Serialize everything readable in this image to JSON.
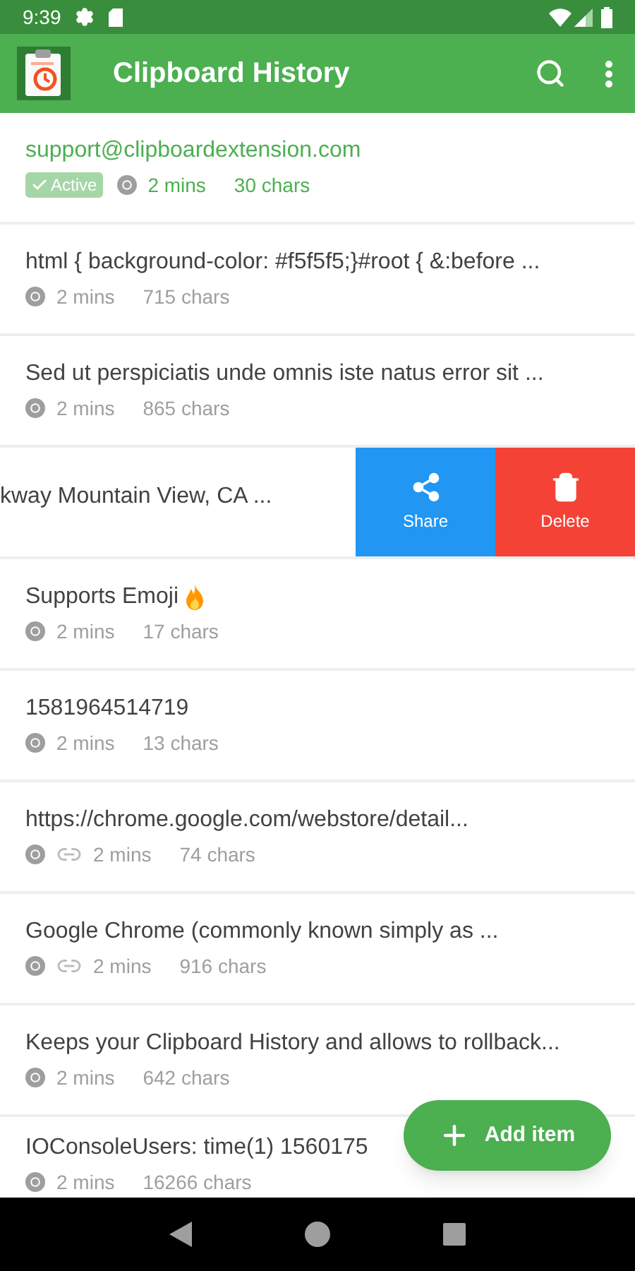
{
  "status_bar": {
    "time": "9:39"
  },
  "app_bar": {
    "title": "Clipboard History"
  },
  "items": [
    {
      "kind": "entry",
      "text": "support@clipboardextension.com",
      "active": true,
      "badge": "Active",
      "link": false,
      "flame": false,
      "time": "2 mins",
      "size": "30 chars"
    },
    {
      "kind": "entry",
      "text": "html { background-color: #f5f5f5;}#root { &:before ...",
      "active": false,
      "link": false,
      "flame": false,
      "time": "2 mins",
      "size": "715 chars"
    },
    {
      "kind": "entry",
      "text": "Sed ut perspiciatis unde omnis iste natus error sit ...",
      "active": false,
      "link": false,
      "flame": false,
      "time": "2 mins",
      "size": "865 chars"
    },
    {
      "kind": "swiped",
      "text": "kway Mountain View, CA ...",
      "actions": [
        {
          "kind": "share",
          "label": "Share"
        },
        {
          "kind": "delete",
          "label": "Delete"
        }
      ]
    },
    {
      "kind": "entry",
      "text": "Supports Emoji",
      "active": false,
      "link": false,
      "flame": true,
      "time": "2 mins",
      "size": "17 chars"
    },
    {
      "kind": "entry",
      "text": "1581964514719",
      "active": false,
      "link": false,
      "flame": false,
      "time": "2 mins",
      "size": "13 chars"
    },
    {
      "kind": "entry",
      "text": "https://chrome.google.com/webstore/detail...",
      "active": false,
      "link": true,
      "flame": false,
      "time": "2 mins",
      "size": "74 chars"
    },
    {
      "kind": "entry",
      "text": "Google Chrome (commonly known simply as ...",
      "active": false,
      "link": true,
      "flame": false,
      "time": "2 mins",
      "size": "916 chars"
    },
    {
      "kind": "entry",
      "text": "Keeps your Clipboard History and allows to rollback...",
      "active": false,
      "link": false,
      "flame": false,
      "time": "2 mins",
      "size": "642 chars"
    },
    {
      "kind": "entry",
      "text": "IOConsoleUsers: time(1) 1560175",
      "active": false,
      "link": false,
      "flame": false,
      "time": "2 mins",
      "size": "16266 chars"
    }
  ],
  "fab": {
    "label": "Add item"
  }
}
